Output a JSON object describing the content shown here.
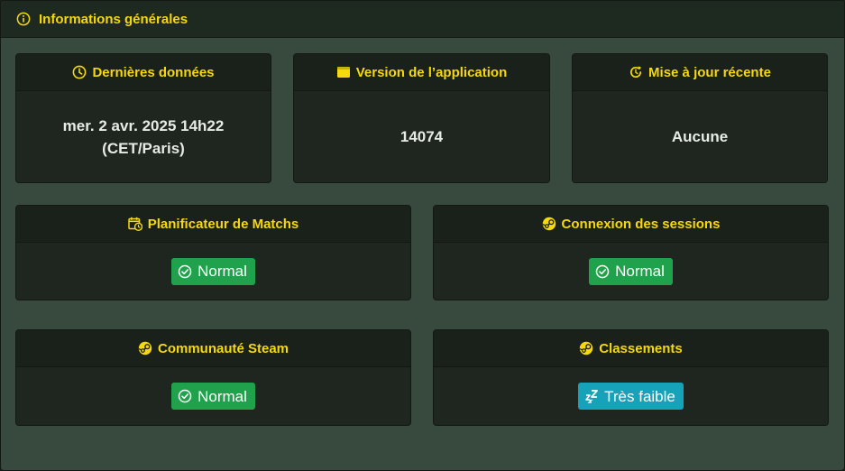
{
  "header": {
    "title": "Informations générales",
    "icon": "info-circle-icon"
  },
  "cards": {
    "last_data": {
      "title": "Dernières données",
      "icon": "clock-icon",
      "line1": "mer. 2 avr. 2025 14h22",
      "line2": "(CET/Paris)"
    },
    "app_version": {
      "title": "Version de l’application",
      "icon": "window-icon",
      "value": "14074"
    },
    "recent_update": {
      "title": "Mise à jour récente",
      "icon": "refresh-icon",
      "value": "Aucune"
    },
    "match_scheduler": {
      "title": "Planificateur de Matchs",
      "icon": "calendar-clock-icon",
      "status": "Normal",
      "status_icon": "check-circle-icon",
      "status_color": "#1fa24b"
    },
    "session_login": {
      "title": "Connexion des sessions",
      "icon": "steam-icon",
      "status": "Normal",
      "status_icon": "check-circle-icon",
      "status_color": "#1fa24b"
    },
    "steam_community": {
      "title": "Communauté Steam",
      "icon": "steam-icon",
      "status": "Normal",
      "status_icon": "check-circle-icon",
      "status_color": "#1fa24b"
    },
    "leaderboards": {
      "title": "Classements",
      "icon": "steam-icon",
      "status": "Très faible",
      "status_icon": "sleep-icon",
      "status_color": "#16a2b8"
    }
  },
  "colors": {
    "accent": "#f5d90a",
    "panel_bg": "#374a3d",
    "card_bg": "#1f2620"
  }
}
